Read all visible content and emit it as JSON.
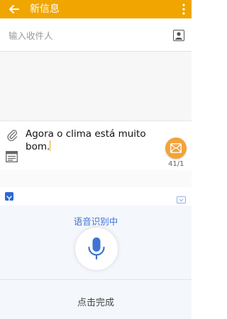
{
  "header": {
    "title": "新信息",
    "accent_color": "#f0a500",
    "back_icon": "back-arrow-icon",
    "more_icon": "more-vert-icon"
  },
  "recipient": {
    "placeholder": "输入收件人",
    "contact_icon": "contact-icon"
  },
  "composer": {
    "message": "Agora o clima está muito bom.",
    "counter": "41/1",
    "attach_icon": "paperclip-icon",
    "template_icon": "template-icon",
    "send_icon": "send-mms-icon"
  },
  "ime": {
    "logo_icon": "ime-logo-icon",
    "collapse_icon": "keyboard-collapse-icon",
    "status": "语音识别中",
    "mic_icon": "microphone-icon",
    "done_label": "点击完成",
    "accent_color": "#3f73d6"
  }
}
